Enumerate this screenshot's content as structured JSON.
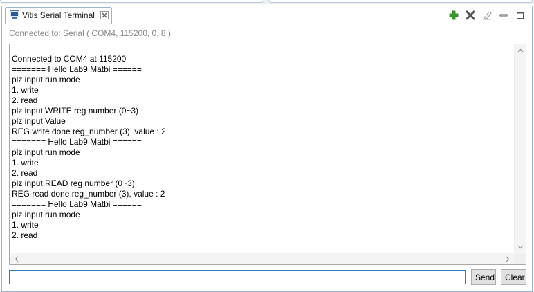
{
  "view": {
    "tab_title": "Vitis Serial Terminal",
    "icons": {
      "tab_icon": "terminal-monitor-icon",
      "close": "close-icon",
      "toolbar": [
        "add-plus-icon",
        "remove-x-icon",
        "eraser-icon",
        "minimize-icon",
        "maximize-icon"
      ]
    }
  },
  "status": {
    "text": "Connected to: Serial ( COM4, 115200, 0, 8 )"
  },
  "console": {
    "lines": [
      "Connected to COM4 at 115200",
      "======= Hello Lab9 Matbi ======",
      "plz input run mode",
      "1. write",
      "2. read",
      "plz input WRITE reg number (0~3)",
      "plz input Value",
      "REG write done reg_number (3), value : 2",
      "======= Hello Lab9 Matbi ======",
      "plz input run mode",
      "1. write",
      "2. read",
      "plz input READ reg number (0~3)",
      "REG read done reg_number (3), value : 2",
      "======= Hello Lab9 Matbi ======",
      "plz input run mode",
      "1. write",
      "2. read"
    ]
  },
  "input": {
    "value": "",
    "send_label": "Send",
    "clear_label": "Clear"
  },
  "colors": {
    "accent_border": "#2f7dbd",
    "tab_border": "#99b4d1",
    "plus_green": "#3c9b2e",
    "status_gray": "#888888"
  }
}
